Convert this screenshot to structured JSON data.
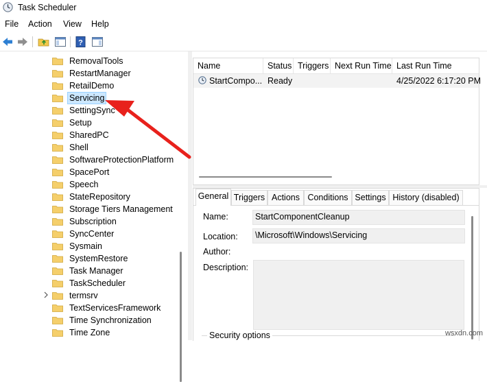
{
  "window": {
    "title": "Task Scheduler"
  },
  "menu": [
    "File",
    "Action",
    "View",
    "Help"
  ],
  "toolbar": {
    "icons": [
      "back-arrow-icon",
      "forward-arrow-icon",
      "folder-up-icon",
      "show-hide-tree-icon",
      "help-icon",
      "show-hide-action-pane-icon"
    ]
  },
  "tree": {
    "items": [
      {
        "label": "RemovalTools"
      },
      {
        "label": "RestartManager"
      },
      {
        "label": "RetailDemo"
      },
      {
        "label": "Servicing",
        "selected": true
      },
      {
        "label": "SettingSync"
      },
      {
        "label": "Setup"
      },
      {
        "label": "SharedPC"
      },
      {
        "label": "Shell"
      },
      {
        "label": "SoftwareProtectionPlatform"
      },
      {
        "label": "SpacePort"
      },
      {
        "label": "Speech"
      },
      {
        "label": "StateRepository"
      },
      {
        "label": "Storage Tiers Management"
      },
      {
        "label": "Subscription"
      },
      {
        "label": "SyncCenter"
      },
      {
        "label": "Sysmain"
      },
      {
        "label": "SystemRestore"
      },
      {
        "label": "Task Manager"
      },
      {
        "label": "TaskScheduler"
      },
      {
        "label": "termsrv",
        "expandable": true
      },
      {
        "label": "TextServicesFramework"
      },
      {
        "label": "Time Synchronization"
      },
      {
        "label": "Time Zone"
      }
    ]
  },
  "tasks": {
    "columns": [
      "Name",
      "Status",
      "Triggers",
      "Next Run Time",
      "Last Run Time"
    ],
    "rows": [
      {
        "name": "StartCompo...",
        "status": "Ready",
        "triggers": "",
        "next_run": "",
        "last_run": "4/25/2022 6:17:20 PM"
      }
    ]
  },
  "props": {
    "tabs": [
      "General",
      "Triggers",
      "Actions",
      "Conditions",
      "Settings",
      "History (disabled)"
    ],
    "name_label": "Name:",
    "name_value": "StartComponentCleanup",
    "location_label": "Location:",
    "location_value": "\\Microsoft\\Windows\\Servicing",
    "author_label": "Author:",
    "description_label": "Description:",
    "security_label": "Security options"
  },
  "watermark": "wsxdn.com",
  "colors": {
    "selection": "#cce8ff",
    "arrow": "#e8211c",
    "folder": "#f5cf6b"
  }
}
